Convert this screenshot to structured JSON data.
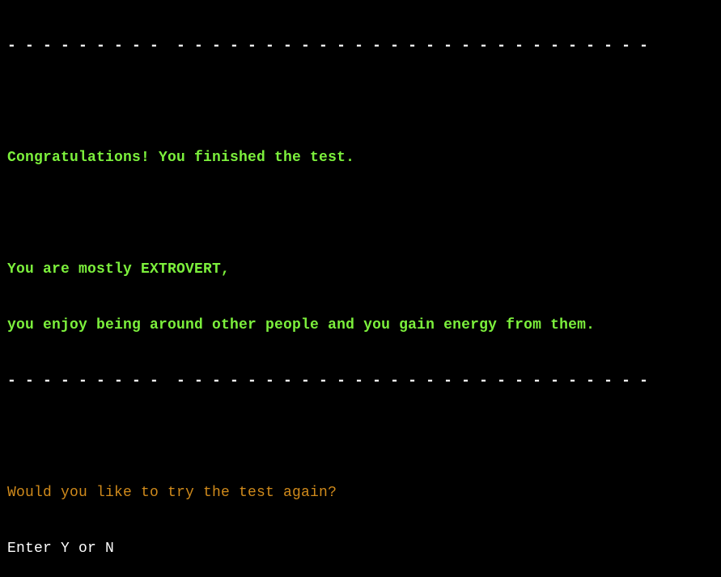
{
  "terminal": {
    "separator_top": "- - - - - - - - -  - - - - - - - - - - - - - - - - - - - - - - - - - - -",
    "congrats": "Congratulations! You finished the test.",
    "result_line1": "You are mostly EXTROVERT,",
    "result_line2": "you enjoy being around other people and you gain energy from them.",
    "separator_bottom": "- - - - - - - - -  - - - - - - - - - - - - - - - - - - - - - - - - - - -",
    "prompt_question": "Would you like to try the test again?",
    "prompt_input": "Enter Y or N"
  },
  "colors": {
    "background": "#000000",
    "result_text": "#7cf03c",
    "prompt_question": "#d08a1b",
    "prompt_input": "#ffffff",
    "separator": "#ffffff"
  }
}
